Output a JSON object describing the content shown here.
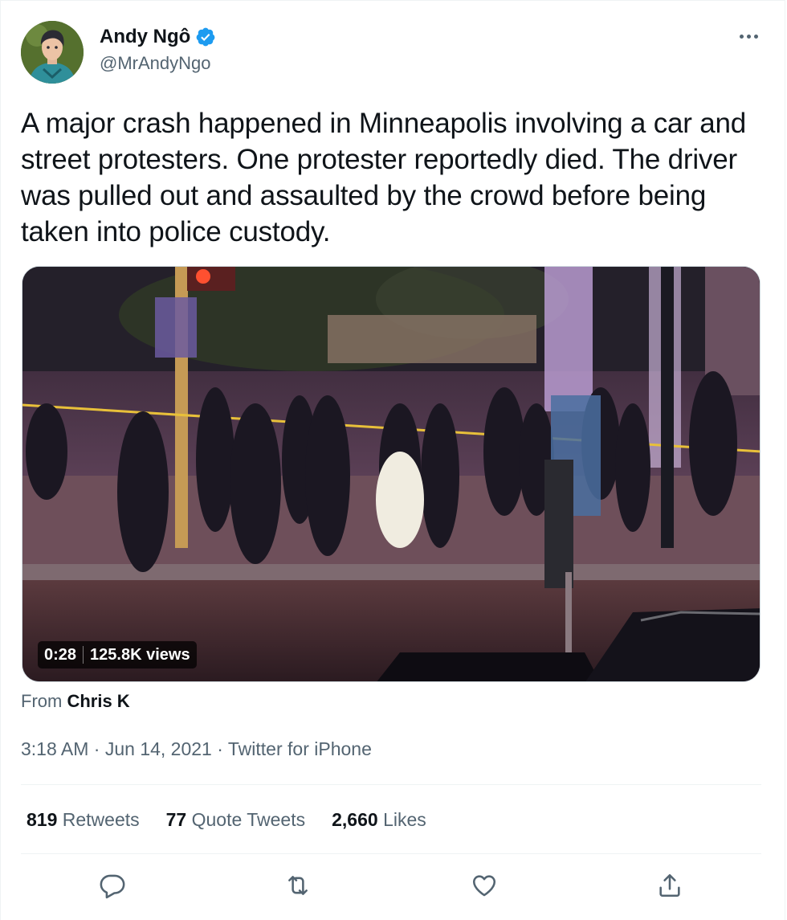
{
  "author": {
    "name": "Andy Ngô",
    "handle": "@MrAndyNgo",
    "verified": true,
    "avatar": "avatar-illustration"
  },
  "tweet": {
    "text": "A major crash happened in Minneapolis involving a car and street protesters. One protester reportedly died. The driver was pulled out and assaulted by the crowd before being taken into police custody."
  },
  "media": {
    "type": "video",
    "duration": "0:28",
    "views": "125.8K views",
    "from_label": "From",
    "from_name": "Chris K"
  },
  "meta": {
    "time": "3:18 AM",
    "date": "Jun 14, 2021",
    "source": "Twitter for iPhone",
    "separator": "·"
  },
  "stats": {
    "retweets_count": "819",
    "retweets_label": "Retweets",
    "quotes_count": "77",
    "quotes_label": "Quote Tweets",
    "likes_count": "2,660",
    "likes_label": "Likes"
  },
  "actions": [
    "reply-icon",
    "retweet-icon",
    "like-icon",
    "share-icon"
  ],
  "colors": {
    "text_primary": "#0f1419",
    "text_secondary": "#536471",
    "verified": "#1d9bf0",
    "border": "#eff3f4"
  }
}
